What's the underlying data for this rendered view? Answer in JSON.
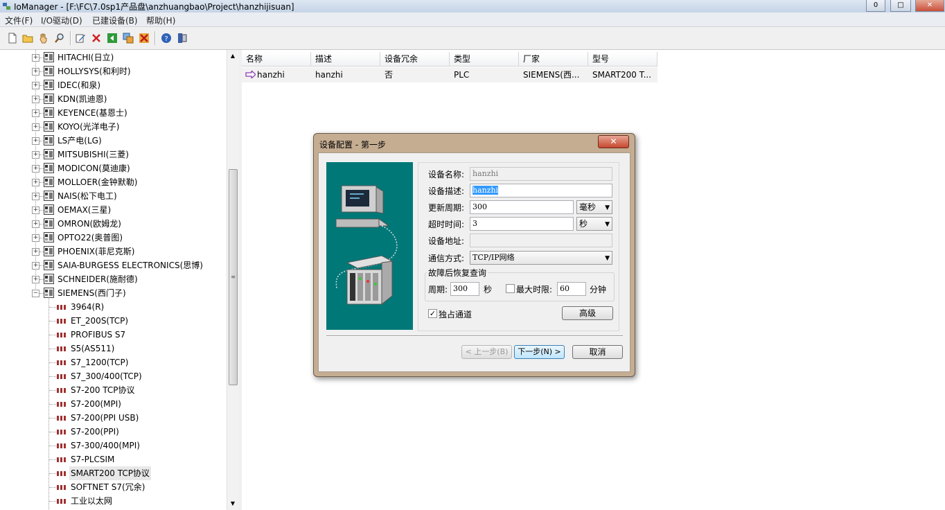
{
  "window": {
    "title": "IoManager - [F:\\FC\\7.0sp1产品盘\\anzhuangbao\\Project\\hanzhijisuan]",
    "minimize": "0",
    "restore": "□",
    "close": "✕"
  },
  "menu": [
    "文件(F)",
    "I/O驱动(D)",
    "已建设备(B)",
    "帮助(H)"
  ],
  "toolbar": {
    "icons": [
      "new-file-icon",
      "open-folder-icon",
      "hand-icon",
      "search-icon",
      "edit-icon",
      "delete-icon",
      "back-icon",
      "copy-icon",
      "cut-icon",
      "help-icon",
      "info-icon"
    ]
  },
  "tree": {
    "vendors": [
      "HITACHI(日立)",
      "HOLLYSYS(和利时)",
      "IDEC(和泉)",
      "KDN(凯迪恩)",
      "KEYENCE(基恩士)",
      "KOYO(光洋电子)",
      "LS产电(LG)",
      "MITSUBISHI(三菱)",
      "MODICON(莫迪康)",
      "MOLLOER(金钟默勒)",
      "NAIS(松下电工)",
      "OEMAX(三星)",
      "OMRON(欧姆龙)",
      "OPTO22(奥普图)",
      "PHOENIX(菲尼克斯)",
      "SAIA-BURGESS ELECTRONICS(思博)",
      "SCHNEIDER(施耐德)",
      "SIEMENS(西门子)"
    ],
    "expanded_index": 17,
    "children": [
      "3964(R)",
      "ET_200S(TCP)",
      "PROFIBUS S7",
      "S5(AS511)",
      "S7_1200(TCP)",
      "S7_300/400(TCP)",
      "S7-200 TCP协议",
      "S7-200(MPI)",
      "S7-200(PPI USB)",
      "S7-200(PPI)",
      "S7-300/400(MPI)",
      "S7-PLCSIM",
      "SMART200 TCP协议",
      "SOFTNET S7(冗余)",
      "工业以太网"
    ],
    "selected_child": 12,
    "collapsed_marker": "+",
    "expanded_marker": "−",
    "scroll_up": "▲",
    "scroll_down": "▼",
    "scroll_grip": "≡"
  },
  "list": {
    "columns": [
      "名称",
      "描述",
      "设备冗余",
      "类型",
      "厂家",
      "型号"
    ],
    "rows": [
      [
        "hanzhi",
        "hanzhi",
        "否",
        "PLC",
        "SIEMENS(西...",
        "SMART200 T..."
      ]
    ]
  },
  "dialog": {
    "title": "设备配置 - 第一步",
    "close": "✕",
    "fields": {
      "name_label": "设备名称:",
      "name_value": "hanzhi",
      "desc_label": "设备描述:",
      "desc_value": "hanzhi",
      "period_label": "更新周期:",
      "period_value": "300",
      "period_unit": "毫秒",
      "timeout_label": "超时时间:",
      "timeout_value": "3",
      "timeout_unit": "秒",
      "address_label": "设备地址:",
      "address_value": "",
      "comm_label": "通信方式:",
      "comm_value": "TCP/IP网络"
    },
    "recovery": {
      "group_label": "故障后恢复查询",
      "cycle_label": "周期:",
      "cycle_value": "300",
      "cycle_unit": "秒",
      "maxtime_label": "最大时限:",
      "maxtime_value": "60",
      "maxtime_unit": "分钟",
      "maxtime_checked": false
    },
    "exclusive_label": "独占通道",
    "exclusive_checked": true,
    "check_mark": "✓",
    "dropdown_arrow": "▼",
    "advanced": "高级",
    "prev": "< 上一步(B)",
    "next": "下一步(N) >",
    "cancel": "取消"
  },
  "colors": {
    "illustration_bg": "#007878",
    "dialog_frame": "#c5ad92",
    "selection": "#3399ff",
    "list_arrow": "#8b3fb0"
  }
}
